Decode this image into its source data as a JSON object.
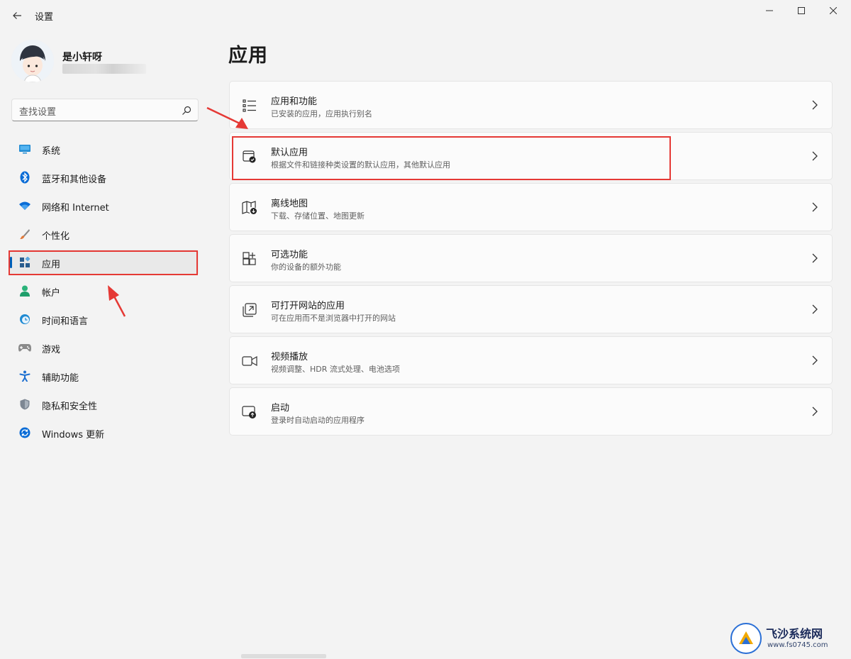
{
  "window": {
    "title": "设置",
    "controls": [
      "minimize",
      "maximize",
      "close"
    ]
  },
  "user": {
    "name": "是小轩呀"
  },
  "search": {
    "placeholder": "查找设置"
  },
  "nav": {
    "items": [
      {
        "label": "系统",
        "icon": "monitor-icon",
        "color": "#1f8ad2"
      },
      {
        "label": "蓝牙和其他设备",
        "icon": "bluetooth-icon",
        "color": "#0a6cd6"
      },
      {
        "label": "网络和 Internet",
        "icon": "wifi-icon",
        "color": "#0a6cd6"
      },
      {
        "label": "个性化",
        "icon": "brush-icon",
        "color": "#e0793a"
      },
      {
        "label": "应用",
        "icon": "apps-icon",
        "color": "#2a5d8f",
        "selected": true
      },
      {
        "label": "帐户",
        "icon": "person-icon",
        "color": "#2bb37a"
      },
      {
        "label": "时间和语言",
        "icon": "globe-clock-icon",
        "color": "#1f8ad2"
      },
      {
        "label": "游戏",
        "icon": "gamepad-icon",
        "color": "#7a7a7a"
      },
      {
        "label": "辅助功能",
        "icon": "accessibility-icon",
        "color": "#1d6fd0"
      },
      {
        "label": "隐私和安全性",
        "icon": "shield-icon",
        "color": "#7d8793"
      },
      {
        "label": "Windows 更新",
        "icon": "sync-icon",
        "color": "#0a6cd6"
      }
    ]
  },
  "main": {
    "title": "应用",
    "cards": [
      {
        "title": "应用和功能",
        "subtitle": "已安装的应用，应用执行别名",
        "icon": "list-icon"
      },
      {
        "title": "默认应用",
        "subtitle": "根据文件和链接种类设置的默认应用，其他默认应用",
        "icon": "default-app-icon"
      },
      {
        "title": "离线地图",
        "subtitle": "下载、存储位置、地图更新",
        "icon": "map-download-icon"
      },
      {
        "title": "可选功能",
        "subtitle": "你的设备的额外功能",
        "icon": "add-grid-icon"
      },
      {
        "title": "可打开网站的应用",
        "subtitle": "可在应用而不是浏览器中打开的网站",
        "icon": "open-link-icon"
      },
      {
        "title": "视频播放",
        "subtitle": "视频调整、HDR 流式处理、电池选项",
        "icon": "video-icon"
      },
      {
        "title": "启动",
        "subtitle": "登录时自动启动的应用程序",
        "icon": "startup-icon"
      }
    ]
  },
  "annotations": {
    "highlight_color": "#e53935"
  },
  "watermark": {
    "title": "飞沙系统网",
    "url": "www.fs0745.com"
  }
}
